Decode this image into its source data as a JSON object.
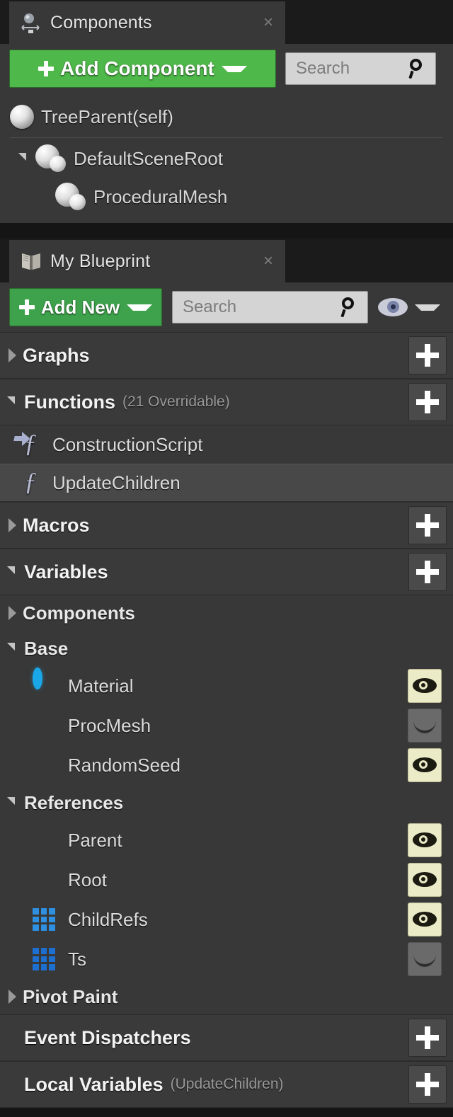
{
  "components_panel": {
    "tab": {
      "label": "Components",
      "icon": "components-icon",
      "close": "×"
    },
    "toolbar": {
      "add_button_label": "Add Component",
      "search_placeholder": "Search",
      "search_value": ""
    },
    "tree": [
      {
        "label": "TreeParent(self)",
        "icon": "sphere-icon",
        "indent": 0,
        "expander": "none"
      },
      {
        "label": "DefaultSceneRoot",
        "icon": "scene-component-icon",
        "indent": 1,
        "expander": "open"
      },
      {
        "label": "ProceduralMesh",
        "icon": "scene-component-icon",
        "indent": 2,
        "expander": "none"
      }
    ]
  },
  "myblueprint_panel": {
    "tab": {
      "label": "My Blueprint",
      "icon": "blueprint-book-icon",
      "close": "×"
    },
    "toolbar": {
      "add_button_label": "Add New",
      "search_placeholder": "Search",
      "search_value": "",
      "visibility_icon": "eye-icon"
    },
    "sections": [
      {
        "title": "Graphs",
        "subtitle": "",
        "expander": "closed",
        "add": "+"
      },
      {
        "title": "Functions",
        "subtitle": "(21 Overridable)",
        "expander": "open",
        "add": "+"
      },
      {
        "title": "Macros",
        "subtitle": "",
        "expander": "closed",
        "add": "+"
      },
      {
        "title": "Variables",
        "subtitle": "",
        "expander": "open",
        "add": "+"
      },
      {
        "title": "Event Dispatchers",
        "subtitle": "",
        "expander": "none",
        "add": "+"
      },
      {
        "title": "Local Variables",
        "subtitle": "(UpdateChildren)",
        "expander": "none",
        "add": "+"
      }
    ],
    "functions": [
      {
        "label": "ConstructionScript",
        "icon": "construction-script-icon",
        "selected": false
      },
      {
        "label": "UpdateChildren",
        "icon": "function-icon",
        "selected": true
      }
    ],
    "variable_categories": [
      {
        "label": "Components",
        "expander": "closed",
        "items": []
      },
      {
        "label": "Base",
        "expander": "open",
        "items": [
          {
            "label": "Material",
            "icon": "object-reference-icon",
            "visibility": "visible"
          },
          {
            "label": "ProcMesh",
            "icon": "object-pill-icon",
            "visibility": "hidden"
          },
          {
            "label": "RandomSeed",
            "icon": "object-pill-icon",
            "visibility": "visible"
          }
        ]
      },
      {
        "label": "References",
        "expander": "open",
        "items": [
          {
            "label": "Parent",
            "icon": "object-sphere-icon",
            "visibility": "visible"
          },
          {
            "label": "Root",
            "icon": "object-sphere-icon",
            "visibility": "visible"
          },
          {
            "label": "ChildRefs",
            "icon": "array-grid-icon",
            "visibility": "visible"
          },
          {
            "label": "Ts",
            "icon": "array-grid-icon",
            "visibility": "hidden"
          }
        ]
      },
      {
        "label": "Pivot Paint",
        "expander": "closed",
        "items": []
      }
    ]
  },
  "colors": {
    "panel_bg": "#383838",
    "window_bg": "#151515",
    "accent_green_add_component": "#4fb84a",
    "accent_green_add_new": "#3da24b",
    "object_blue": "#1aa7e8",
    "array_blue": "#2f8fe0",
    "visible_eye_bg": "#ecebc8"
  }
}
